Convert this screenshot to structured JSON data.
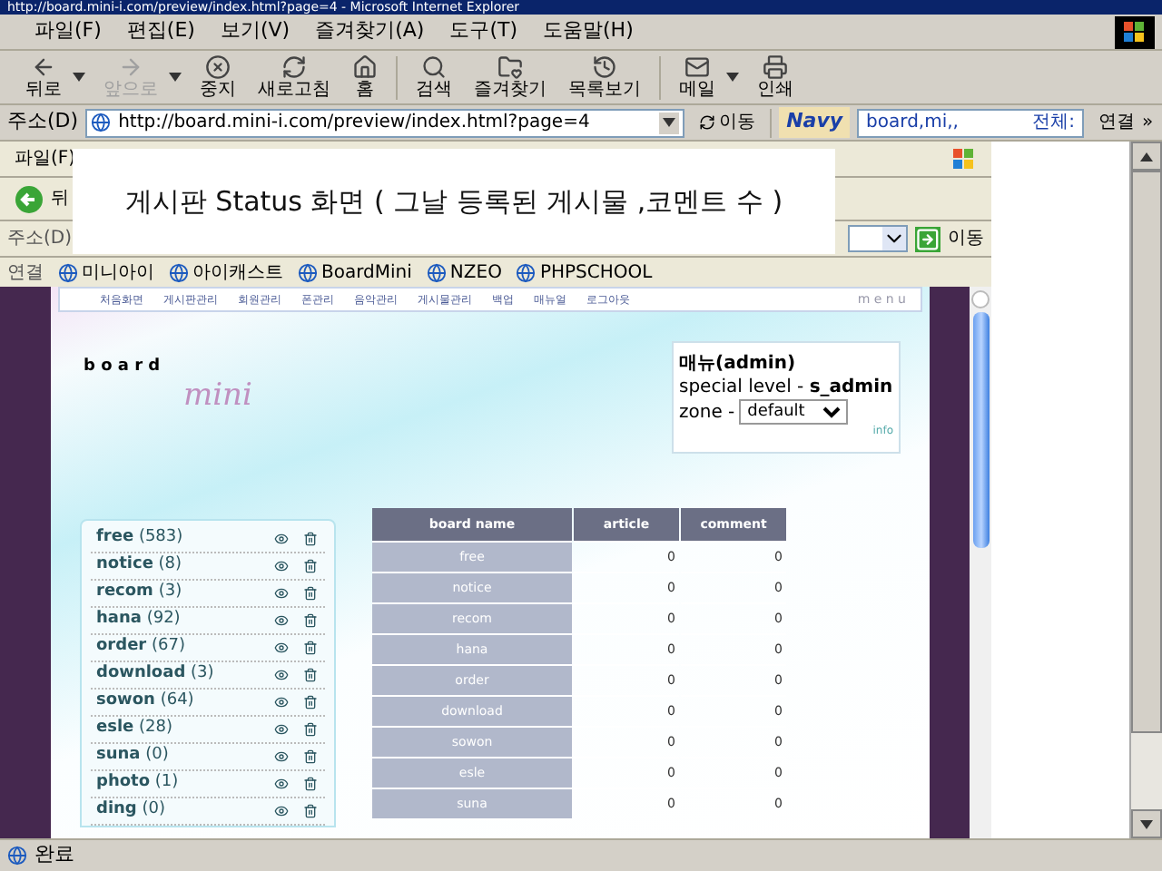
{
  "window": {
    "title": "http://board.mini-i.com/preview/index.html?page=4 - Microsoft Internet Explorer"
  },
  "menu": [
    "파일(F)",
    "편집(E)",
    "보기(V)",
    "즐겨찾기(A)",
    "도구(T)",
    "도움말(H)"
  ],
  "toolbar": [
    {
      "label": "뒤로",
      "disabled": false,
      "dropdown": true
    },
    {
      "label": "앞으로",
      "disabled": true,
      "dropdown": true
    },
    {
      "label": "중지",
      "disabled": false,
      "dropdown": false
    },
    {
      "label": "새로고침",
      "disabled": false,
      "dropdown": false
    },
    {
      "label": "홈",
      "disabled": false,
      "dropdown": false
    },
    {
      "label": "검색",
      "disabled": false,
      "dropdown": false
    },
    {
      "label": "즐겨찾기",
      "disabled": false,
      "dropdown": false
    },
    {
      "label": "목록보기",
      "disabled": false,
      "dropdown": false
    },
    {
      "label": "메일",
      "disabled": false,
      "dropdown": true
    },
    {
      "label": "인쇄",
      "disabled": false,
      "dropdown": false
    }
  ],
  "address_bar": {
    "label": "주소(D)",
    "value": "http://board.mini-i.com/preview/index.html?page=4",
    "go": "이동",
    "search_logo": "Navy",
    "search_value": "board,mi,,",
    "search_scope": "전체:",
    "links": "연결",
    "more": "»"
  },
  "inner_browser": {
    "menu": [
      "파일(F)"
    ],
    "back": "뒤",
    "address_label": "주소(D)",
    "go": "이동",
    "links_label": "연결",
    "links": [
      "미니아이",
      "아이캐스트",
      "BoardMini",
      "NZEO",
      "PHPSCHOOL"
    ]
  },
  "caption": "게시판 Status 화면 ( 그날 등록된 게시물 ,코멘트 수 )",
  "page": {
    "nav": [
      "처음화면",
      "게시판관리",
      "회원관리",
      "폰관리",
      "음악관리",
      "게시물관리",
      "백업",
      "매뉴얼",
      "로그아웃"
    ],
    "nav_label": "m e n u",
    "logo_word": "b o a r d",
    "logo_script": "mini",
    "user": {
      "name": "매뉴(admin)",
      "level_label": "special level - ",
      "level": "s_admin",
      "zone_label": "zone - ",
      "zone": "default",
      "info": "info"
    },
    "boards": [
      {
        "name": "free",
        "count": "(583)"
      },
      {
        "name": "notice",
        "count": "(8)"
      },
      {
        "name": "recom",
        "count": "(3)"
      },
      {
        "name": "hana",
        "count": "(92)"
      },
      {
        "name": "order",
        "count": "(67)"
      },
      {
        "name": "download",
        "count": "(3)"
      },
      {
        "name": "sowon",
        "count": "(64)"
      },
      {
        "name": "esle",
        "count": "(28)"
      },
      {
        "name": "suna",
        "count": "(0)"
      },
      {
        "name": "photo",
        "count": "(1)"
      },
      {
        "name": "ding",
        "count": "(0)"
      }
    ],
    "table": {
      "columns": [
        "board name",
        "article",
        "comment"
      ],
      "rows": [
        [
          "free",
          "0",
          "0"
        ],
        [
          "notice",
          "0",
          "0"
        ],
        [
          "recom",
          "0",
          "0"
        ],
        [
          "hana",
          "0",
          "0"
        ],
        [
          "order",
          "0",
          "0"
        ],
        [
          "download",
          "0",
          "0"
        ],
        [
          "sowon",
          "0",
          "0"
        ],
        [
          "esle",
          "0",
          "0"
        ],
        [
          "suna",
          "0",
          "0"
        ]
      ]
    }
  },
  "status_bar": {
    "text": "완료"
  }
}
